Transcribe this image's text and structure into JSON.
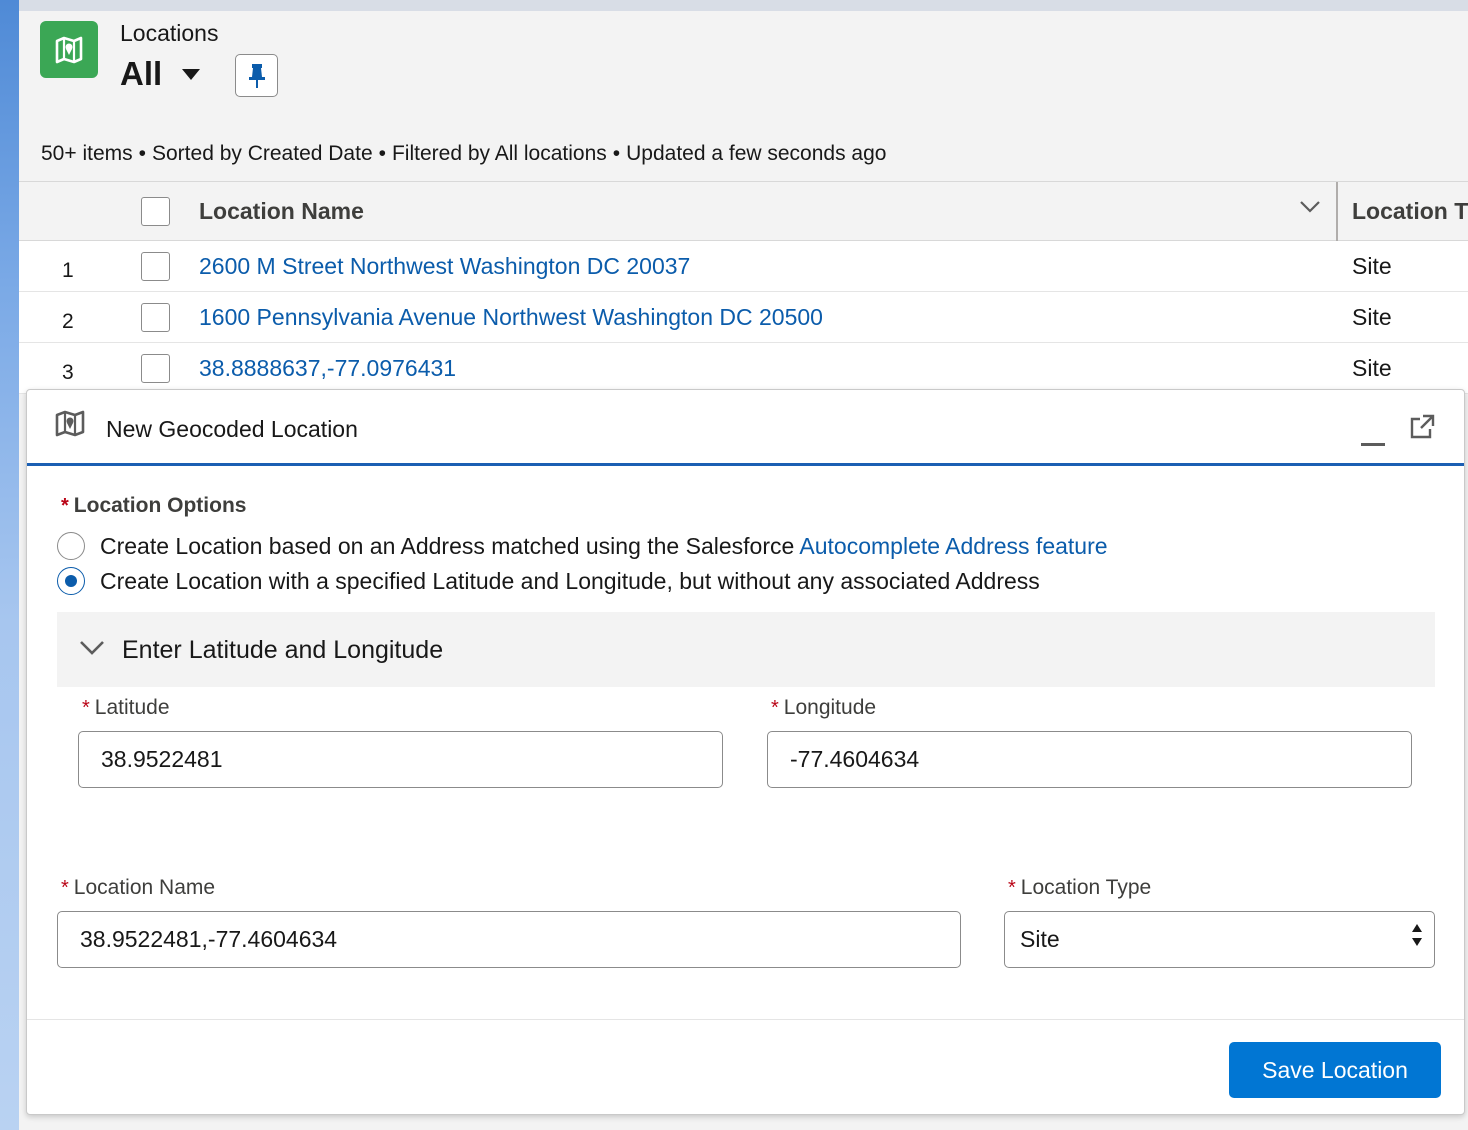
{
  "header": {
    "object_label": "Locations",
    "list_view": "All",
    "icon": "location-map-icon",
    "accent_color": "#3ba755"
  },
  "meta": {
    "count": "50+ items",
    "sorted": "Sorted by Created Date",
    "filtered": "Filtered by All locations",
    "updated": "Updated a few seconds ago",
    "separator": "•"
  },
  "table": {
    "columns": [
      "Location Name",
      "Location T"
    ],
    "rows": [
      {
        "num": "1",
        "name": "2600 M Street Northwest Washington DC 20037",
        "type": "Site"
      },
      {
        "num": "2",
        "name": "1600 Pennsylvania Avenue Northwest Washington DC 20500",
        "type": "Site"
      },
      {
        "num": "3",
        "name": "38.8888637,-77.0976431",
        "type": "Site"
      }
    ]
  },
  "panel": {
    "title": "New Geocoded Location",
    "options_label": "Location Options",
    "required_marker": "*",
    "option1_text": "Create Location based on an Address matched using the Salesforce ",
    "option1_link": "Autocomplete Address feature",
    "option2_text": "Create Location with a specified Latitude and Longitude, but without any associated Address",
    "selected_option": 2,
    "section_title": "Enter Latitude and Longitude",
    "latitude_label": "Latitude",
    "latitude_value": "38.9522481",
    "longitude_label": "Longitude",
    "longitude_value": "-77.4604634",
    "name_label": "Location Name",
    "name_value": "38.9522481,-77.4604634",
    "type_label": "Location Type",
    "type_value": "Site",
    "save_label": "Save Location",
    "brand_color": "#0176d3",
    "link_color": "#0b5cab"
  }
}
